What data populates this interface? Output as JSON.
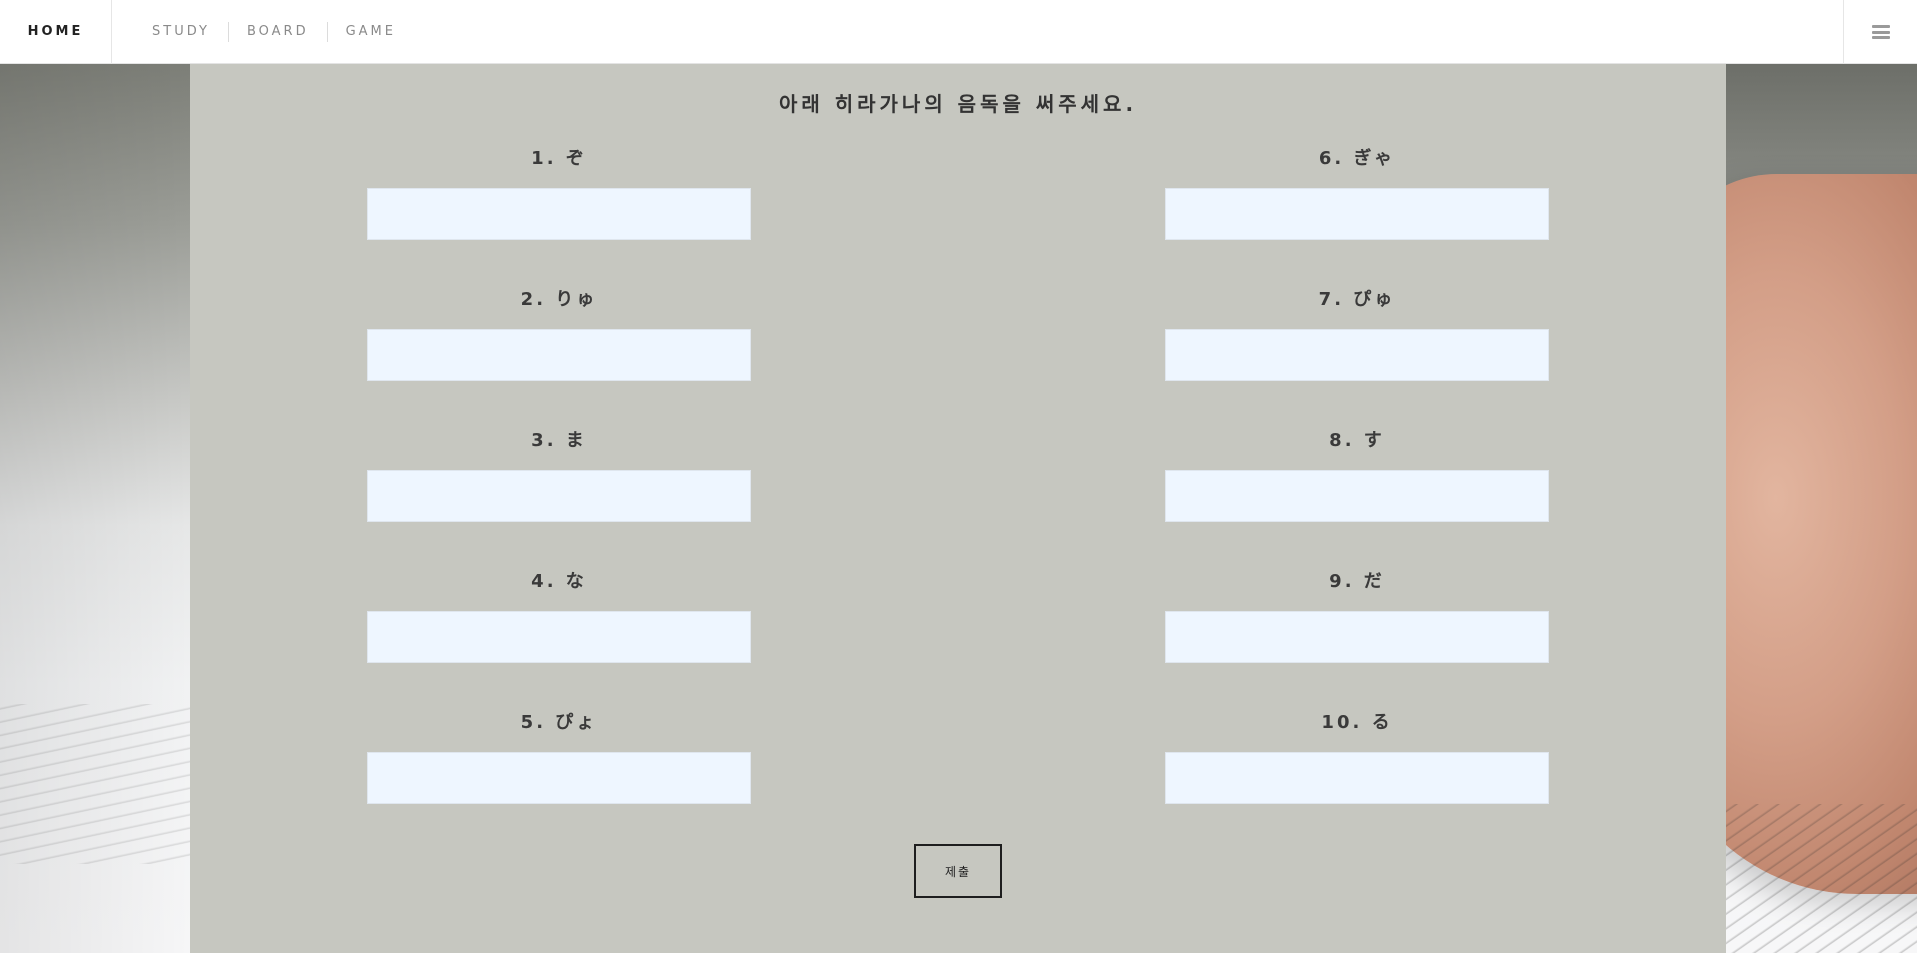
{
  "header": {
    "brand": "HOME",
    "nav": [
      "STUDY",
      "BOARD",
      "GAME"
    ]
  },
  "quiz": {
    "instruction": "아래 히라가나의 음독을 써주세요.",
    "left": [
      {
        "label": "1. ぞ",
        "value": "",
        "placeholder": ""
      },
      {
        "label": "2. りゅ",
        "value": "",
        "placeholder": ""
      },
      {
        "label": "3. ま",
        "value": "",
        "placeholder": ""
      },
      {
        "label": "4. な",
        "value": "",
        "placeholder": ""
      },
      {
        "label": "5. ぴょ",
        "value": "",
        "placeholder": ""
      }
    ],
    "right": [
      {
        "label": "6. ぎゃ",
        "value": "",
        "placeholder": ""
      },
      {
        "label": "7. ぴゅ",
        "value": "",
        "placeholder": ""
      },
      {
        "label": "8. す",
        "value": "",
        "placeholder": ""
      },
      {
        "label": "9. だ",
        "value": "",
        "placeholder": ""
      },
      {
        "label": "10. る",
        "value": "",
        "placeholder": ""
      }
    ],
    "submit_label": "제출"
  },
  "colors": {
    "panel": "#c6c7c0",
    "input_bg": "#eef6ff",
    "header_bg": "#ffffff"
  }
}
